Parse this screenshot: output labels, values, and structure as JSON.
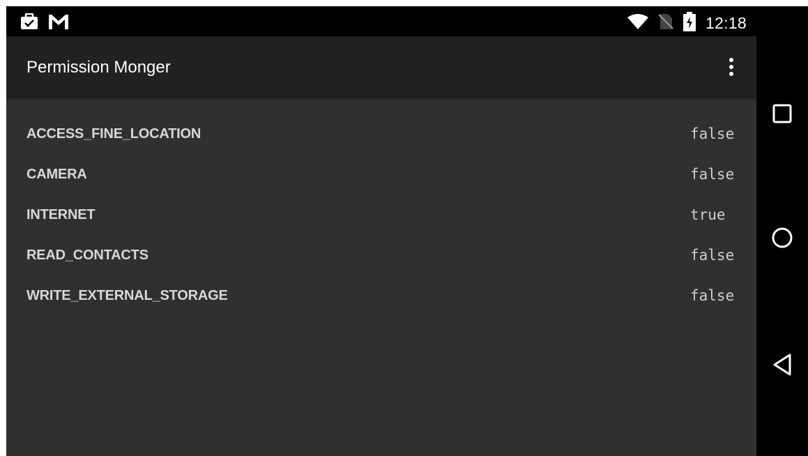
{
  "status_bar": {
    "time": "12:18",
    "left_icons": [
      "briefcase-check-icon",
      "gmail-icon"
    ],
    "right_icons": [
      "wifi-icon",
      "no-sim-icon",
      "battery-charging-icon"
    ]
  },
  "app_bar": {
    "title": "Permission Monger",
    "overflow_icon": "more-vert-icon"
  },
  "permissions": [
    {
      "name": "ACCESS_FINE_LOCATION",
      "value": "false"
    },
    {
      "name": "CAMERA",
      "value": "false"
    },
    {
      "name": "INTERNET",
      "value": "true"
    },
    {
      "name": "READ_CONTACTS",
      "value": "false"
    },
    {
      "name": "WRITE_EXTERNAL_STORAGE",
      "value": "false"
    }
  ],
  "nav_bar": {
    "buttons": [
      "recents-icon",
      "home-icon",
      "back-icon"
    ]
  },
  "colors": {
    "status_bar": "#000000",
    "app_bar": "#212121",
    "content": "#303030",
    "text_primary": "#ffffff",
    "list_text": "#d8d8d8"
  }
}
